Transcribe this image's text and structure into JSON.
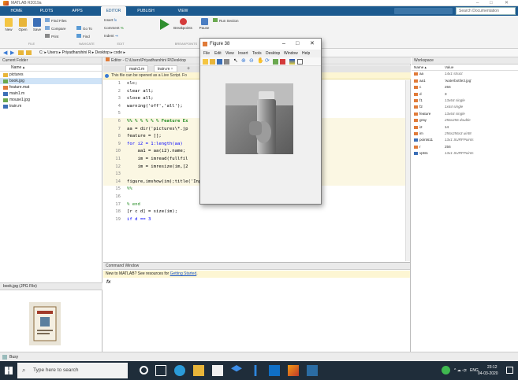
{
  "window": {
    "title": "MATLAB R2019a"
  },
  "ribbon": {
    "tabs": [
      "HOME",
      "PLOTS",
      "APPS",
      "EDITOR",
      "PUBLISH",
      "VIEW"
    ],
    "search_placeholder": "Search Documentation",
    "buttons": {
      "new": "New",
      "open": "Open",
      "save": "Save",
      "find_files": "Find Files",
      "compare": "Compare",
      "print": "Print",
      "insert": "Insert",
      "comment": "Comment",
      "indent": "Indent",
      "goto": "Go To",
      "find": "Find",
      "breakpoints": "Breakpoints",
      "pause": "Pause",
      "run_section": "Run Section"
    },
    "groups": [
      "FILE",
      "NAVIGATE",
      "EDIT",
      "BREAKPOINTS"
    ]
  },
  "address": {
    "path": "C: ▸ Users ▸ Priyadharshini R ▸ Desktop ▸ code ▸"
  },
  "current_folder": {
    "title": "Current Folder",
    "name_header": "Name ▴",
    "items": [
      {
        "name": "pictures",
        "type": "folder"
      },
      {
        "name": "book.jpg",
        "type": "image",
        "selected": true
      },
      {
        "name": "feature.mat",
        "type": "mat"
      },
      {
        "name": "main1.m",
        "type": "m"
      },
      {
        "name": "mouse1.jpg",
        "type": "image"
      },
      {
        "name": "train.m",
        "type": "m"
      }
    ],
    "details_title": "book.jpg (JPG File)"
  },
  "editor": {
    "title": "Editor - C:\\Users\\Priyadharshini R\\Desktop",
    "tabs": [
      "main1.m",
      "train.m"
    ],
    "livescript_msg": "This file can be opened as a Live Script. Fo",
    "lines": [
      {
        "n": "1",
        "text": "clc;"
      },
      {
        "n": "2",
        "text": "clear all;"
      },
      {
        "n": "3",
        "text": "close all;"
      },
      {
        "n": "4",
        "text": "warning('off','all');"
      },
      {
        "n": "5",
        "text": ""
      },
      {
        "n": "6",
        "text": "%% % % % % % Feature Ex"
      },
      {
        "n": "7",
        "text": "aa = dir('pictures\\*.jp"
      },
      {
        "n": "8",
        "text": "feature = [];"
      },
      {
        "n": "9",
        "text": "for i2 = 1:length(aa)"
      },
      {
        "n": "10",
        "text": "    aa1 = aa(i2).name;"
      },
      {
        "n": "11",
        "text": "    im = imread(fullfil"
      },
      {
        "n": "12",
        "text": "    im = imresize(im,[2"
      },
      {
        "n": "13",
        "text": ""
      },
      {
        "n": "14",
        "text": "figure,imshow(im);title('Input image');"
      },
      {
        "n": "15",
        "text": "%%"
      },
      {
        "n": "16",
        "text": ""
      },
      {
        "n": "17",
        "text": "% end"
      },
      {
        "n": "18",
        "text": "[r c d] = size(im);"
      },
      {
        "n": "19",
        "text": "if d == 3"
      }
    ]
  },
  "command_window": {
    "title": "Command Window",
    "message": "New to MATLAB? See resources for ",
    "link": "Getting Started",
    "message_end": ".",
    "prompt": "fx"
  },
  "workspace": {
    "title": "Workspace",
    "headers": [
      "Name ▴",
      "Value"
    ],
    "vars": [
      {
        "name": "aa",
        "value": "14x1 struct",
        "italic": true
      },
      {
        "name": "aa1",
        "value": "'waterbottle3.jpg'",
        "italic": false
      },
      {
        "name": "c",
        "value": "256",
        "italic": false
      },
      {
        "name": "d",
        "value": "3",
        "italic": false
      },
      {
        "name": "f1",
        "value": "13x64 single",
        "italic": true
      },
      {
        "name": "f2",
        "value": "1x64 single",
        "italic": true
      },
      {
        "name": "feature",
        "value": "13x64 single",
        "italic": true
      },
      {
        "name": "gray",
        "value": "256x256 double",
        "italic": true
      },
      {
        "name": "i2",
        "value": "14",
        "italic": false
      },
      {
        "name": "im",
        "value": "256x256x3 uint8",
        "italic": true
      },
      {
        "name": "points11",
        "value": "13x1 SURFPoints",
        "italic": true
      },
      {
        "name": "r",
        "value": "256",
        "italic": false
      },
      {
        "name": "vpts1",
        "value": "13x1 SURFPoints",
        "italic": true
      }
    ]
  },
  "figure": {
    "title": "Figure 38",
    "menu": [
      "File",
      "Edit",
      "View",
      "Insert",
      "Tools",
      "Desktop",
      "Window",
      "Help"
    ]
  },
  "status": {
    "text": "Busy"
  },
  "taskbar": {
    "search_placeholder": "Type here to search",
    "lang": "ENG",
    "time": "23:12",
    "date": "04-03-2020"
  },
  "colors": {
    "ribbon_blue": "#1c5a8f",
    "taskbar": "#1f2d3a",
    "string": "#a020f0",
    "comment": "#228b22",
    "keyword": "#0000ff"
  }
}
